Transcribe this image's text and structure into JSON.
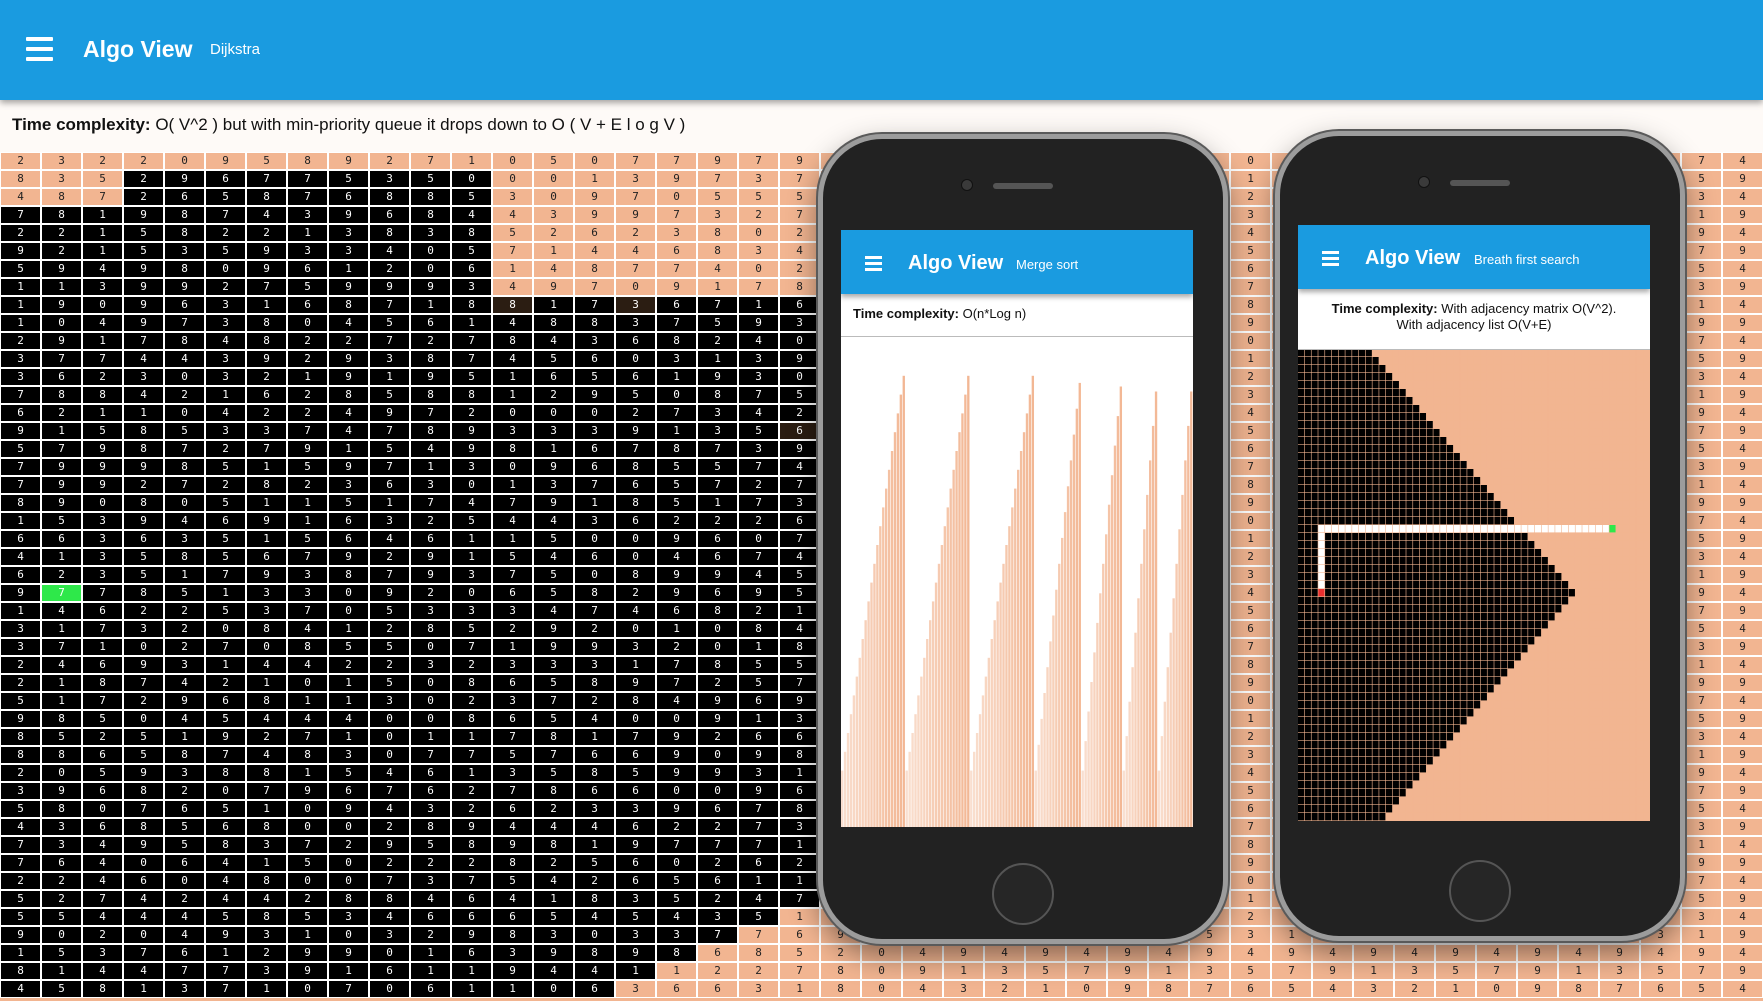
{
  "app": {
    "title": "Algo View",
    "algorithm": "Dijkstra"
  },
  "complexity": {
    "label": "Time complexity:",
    "text": "O( V^2 ) but with min-priority queue it drops down to O ( V + E l o g V )"
  },
  "colors": {
    "primary": "#1a9be0",
    "unvisited": "#f2b591",
    "visited": "#000000",
    "start": "#2ee84a",
    "end": "#e83030"
  },
  "icons": {
    "menu": "hamburger-icon"
  },
  "grid_rows": [
    "2322095892710507797930",
    "8352967753500013973750",
    "4872658768853097055510",
    "7819874396844399732760",
    "2215822138385262380250",
    "9215359334057144683450",
    "5949809612061487740210",
    "1139927599934970917820",
    "1909631687188173671680",
    "1049738045614883759300",
    "2917848227278436824090",
    "3774439293874560313900",
    "3623032191951656193040",
    "7884216285881295087500",
    "6211042249720002734220",
    "9158533747893339135620",
    "5798727915498167873970",
    "7999851597130968557480",
    "7992728236301376572770",
    "8908051151747918517360",
    "1539469163254436222640",
    "6636351564611500960700",
    "4135856792915460467480",
    "6235179387937508994560",
    "9778513309206582969570",
    "1462253705333474682150",
    "3173208412852920108450",
    "3710270855071993201840",
    "2469314422323331785570",
    "2187421015086589725700",
    "5172968113023728496970",
    "9850454440086540091390",
    "8525192710117817926660",
    "8865874830775766909850",
    "2059388154613585993120",
    "3968207967627866009670",
    "5807651094326233967810",
    "4368568002894446227370",
    "7349583729589819777180",
    "7640641502228256026220",
    "2246048007375426561190",
    "5274244288464183524790",
    "5544458534666545435190",
    "9020493103298303377690",
    "1537612990163989868520",
    "8144773916119441122780",
    "4581371070611063663180"
  ],
  "phone_merge": {
    "title": "Algo View",
    "algorithm": "Merge sort",
    "complexity_label": "Time complexity:",
    "complexity_text": "O(n*Log n)"
  },
  "phone_bfs": {
    "title": "Algo View",
    "algorithm": "Breath first search",
    "complexity_label": "Time complexity:",
    "complexity_text_1": "With adjacency matrix O(V^2).",
    "complexity_text_2": "With adjacency list O(V+E)"
  }
}
